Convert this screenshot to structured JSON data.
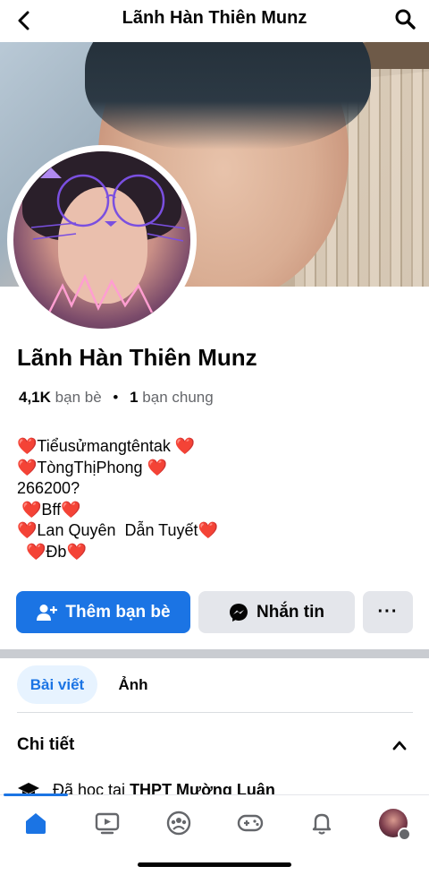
{
  "header": {
    "title": "Lãnh Hàn Thiên Munz"
  },
  "profile": {
    "name": "Lãnh Hàn Thiên Munz",
    "friends_count": "4,1K",
    "friends_label": "bạn bè",
    "separator": "•",
    "mutual_count": "1",
    "mutual_label": "bạn chung",
    "bio": [
      {
        "pre": "",
        "text": "Tiểusửmangtêntak ",
        "post": "❤️"
      },
      {
        "pre": "",
        "text": "TòngThịPhong ",
        "post": "❤️"
      },
      {
        "pre": "",
        "text": "266200?",
        "post": ""
      },
      {
        "pre": " ❤️",
        "text": "Bff",
        "post": "❤️"
      },
      {
        "pre": "",
        "text": "Lan Quyên  Dẫn Tuyết",
        "post": "❤️"
      },
      {
        "pre": "  ❤️",
        "text": "Đb",
        "post": "❤️"
      }
    ],
    "heart": "❤️"
  },
  "actions": {
    "add_friend_label": "Thêm bạn bè",
    "message_label": "Nhắn tin",
    "more_label": "···"
  },
  "tabs": [
    {
      "label": "Bài viết",
      "active": true
    },
    {
      "label": "Ảnh",
      "active": false
    }
  ],
  "details": {
    "title": "Chi tiết",
    "education_prefix": "Đã học tại",
    "education_school": "THPT Mường Luân"
  },
  "bottom_nav": {
    "items": [
      "home-icon",
      "video-icon",
      "groups-icon",
      "gaming-icon",
      "notifications-icon",
      "profile-avatar"
    ]
  },
  "colors": {
    "accent": "#1b74e4",
    "heart": "#e0242f",
    "secondary_button": "#e4e6eb"
  }
}
